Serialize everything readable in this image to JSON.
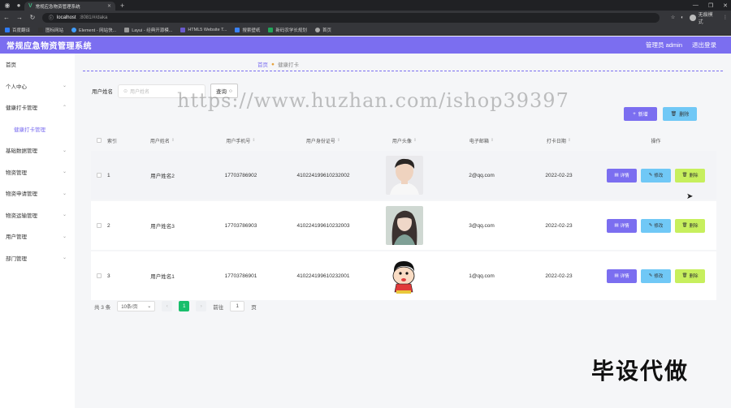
{
  "browser": {
    "tab_title": "常规应急物资管理系统",
    "url_host": "localhost",
    "url_path": ":8081/#/daka",
    "profile_label": "无痕模式",
    "bookmarks": [
      "百度翻译",
      "图标网站",
      "Element - 网站快...",
      "Layui - 经典开源模...",
      "HTML5 Website T...",
      "搜索壁纸",
      "新码农学长规划",
      "首页"
    ]
  },
  "header": {
    "title": "常规应急物资管理系统",
    "admin_label": "管理员 admin",
    "logout_label": "退出登录"
  },
  "sidebar": {
    "items": [
      {
        "label": "首页"
      },
      {
        "label": "个人中心"
      },
      {
        "label": "健康打卡管理"
      },
      {
        "label": "健康打卡管理"
      },
      {
        "label": "基础数据管理"
      },
      {
        "label": "物资管理"
      },
      {
        "label": "物资申请管理"
      },
      {
        "label": "物资运输管理"
      },
      {
        "label": "用户管理"
      },
      {
        "label": "部门管理"
      }
    ]
  },
  "breadcrumb": {
    "home": "首页",
    "current": "健康打卡"
  },
  "search": {
    "label": "用户姓名",
    "placeholder": "用户姓名",
    "button": "查询"
  },
  "actions": {
    "add": "新增",
    "delete": "删除"
  },
  "table": {
    "headers": [
      "索引",
      "用户姓名",
      "用户手机号",
      "用户身份证号",
      "用户头像",
      "电子邮箱",
      "打卡日期",
      "操作"
    ],
    "rows": [
      {
        "index": "1",
        "name": "用户姓名2",
        "phone": "17703786902",
        "idcard": "410224199610232002",
        "email": "2@qq.com",
        "date": "2022-02-23",
        "avatar": "young-man-photo"
      },
      {
        "index": "2",
        "name": "用户姓名3",
        "phone": "17703786903",
        "idcard": "410224199610232003",
        "email": "3@qq.com",
        "date": "2022-02-23",
        "avatar": "young-woman-photo"
      },
      {
        "index": "3",
        "name": "用户姓名1",
        "phone": "17703786901",
        "idcard": "410224199610232001",
        "email": "1@qq.com",
        "date": "2022-02-23",
        "avatar": "cartoon-boy-drawing"
      }
    ],
    "op_labels": {
      "detail": "详情",
      "edit": "修改",
      "remove": "删除"
    }
  },
  "pager": {
    "total": "共 3 条",
    "page_size": "10条/页",
    "current_page": "1",
    "goto_label": "前往",
    "goto_value": "1",
    "page_unit": "页"
  },
  "overlay": {
    "watermark": "https://www.huzhan.com/ishop39397",
    "stamp": "毕设代做"
  },
  "colors": {
    "primary": "#7b6ef0",
    "info": "#70c8f6",
    "lime": "#c7ef5d",
    "success": "#19be6b"
  }
}
